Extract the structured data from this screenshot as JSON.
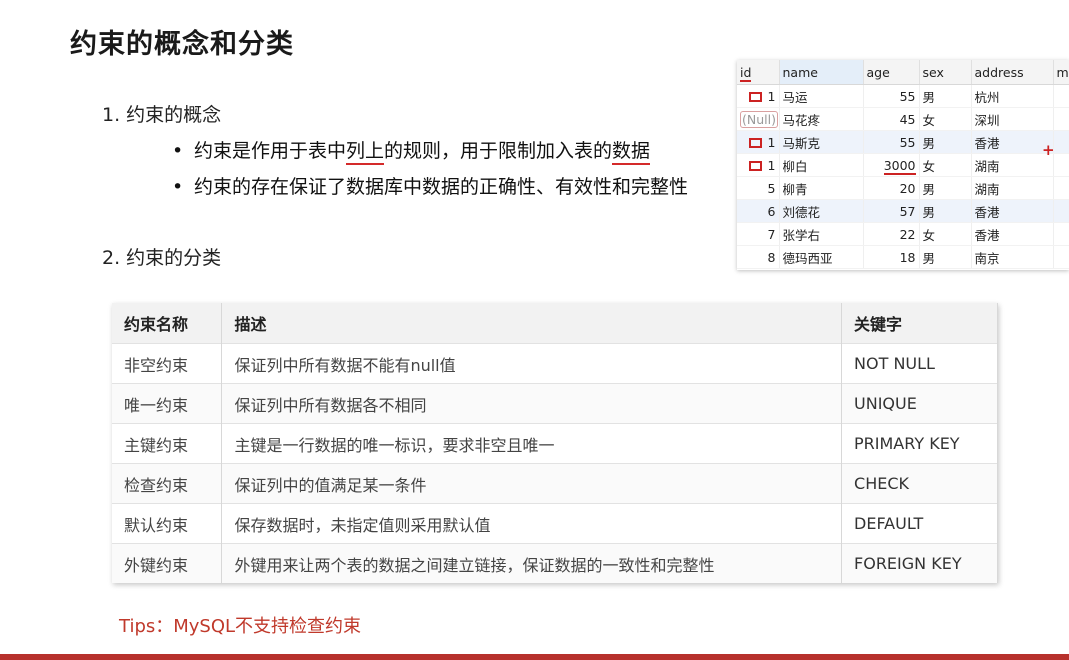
{
  "slide": {
    "title": "约束的概念和分类",
    "section1": "1. 约束的概念",
    "bullets": [
      {
        "pre": "约束是作用于表中",
        "mark1": "列上",
        "mid": "的规则，用于限制加入表的",
        "mark2": "数据"
      },
      {
        "text": "约束的存在保证了数据库中数据的正确性、有效性和完整性"
      }
    ],
    "section2": "2. 约束的分类",
    "tips": "Tips：MySQL不支持检查约束"
  },
  "grid": {
    "headers": [
      "id",
      "name",
      "age",
      "sex",
      "address",
      "m"
    ],
    "rows": [
      {
        "id": "1",
        "name": "马运",
        "age": "55",
        "sex": "男",
        "address": "杭州"
      },
      {
        "id": "(Null)",
        "name": "马花疼",
        "age": "45",
        "sex": "女",
        "address": "深圳"
      },
      {
        "id": "1",
        "name": "马斯克",
        "age": "55",
        "sex": "男",
        "address": "香港"
      },
      {
        "id": "1",
        "name": "柳白",
        "age": "3000",
        "sex": "女",
        "address": "湖南"
      },
      {
        "id": "5",
        "name": "柳青",
        "age": "20",
        "sex": "男",
        "address": "湖南"
      },
      {
        "id": "6",
        "name": "刘德花",
        "age": "57",
        "sex": "男",
        "address": "香港"
      },
      {
        "id": "7",
        "name": "张学右",
        "age": "22",
        "sex": "女",
        "address": "香港"
      },
      {
        "id": "8",
        "name": "德玛西亚",
        "age": "18",
        "sex": "男",
        "address": "南京"
      }
    ],
    "plus": "+"
  },
  "constraints": {
    "headers": [
      "约束名称",
      "描述",
      "关键字"
    ],
    "rows": [
      {
        "name": "非空约束",
        "desc": "保证列中所有数据不能有null值",
        "kw": "NOT NULL"
      },
      {
        "name": "唯一约束",
        "desc": "保证列中所有数据各不相同",
        "kw": "UNIQUE"
      },
      {
        "name": "主键约束",
        "desc": "主键是一行数据的唯一标识，要求非空且唯一",
        "kw": "PRIMARY KEY"
      },
      {
        "name": "检查约束",
        "desc": "保证列中的值满足某一条件",
        "kw": "CHECK"
      },
      {
        "name": "默认约束",
        "desc": "保存数据时，未指定值则采用默认值",
        "kw": "DEFAULT"
      },
      {
        "name": "外键约束",
        "desc": "外键用来让两个表的数据之间建立链接，保证数据的一致性和完整性",
        "kw": "FOREIGN KEY"
      }
    ]
  },
  "colors": {
    "accent": "#b7312c",
    "annotation": "#cc2222"
  }
}
